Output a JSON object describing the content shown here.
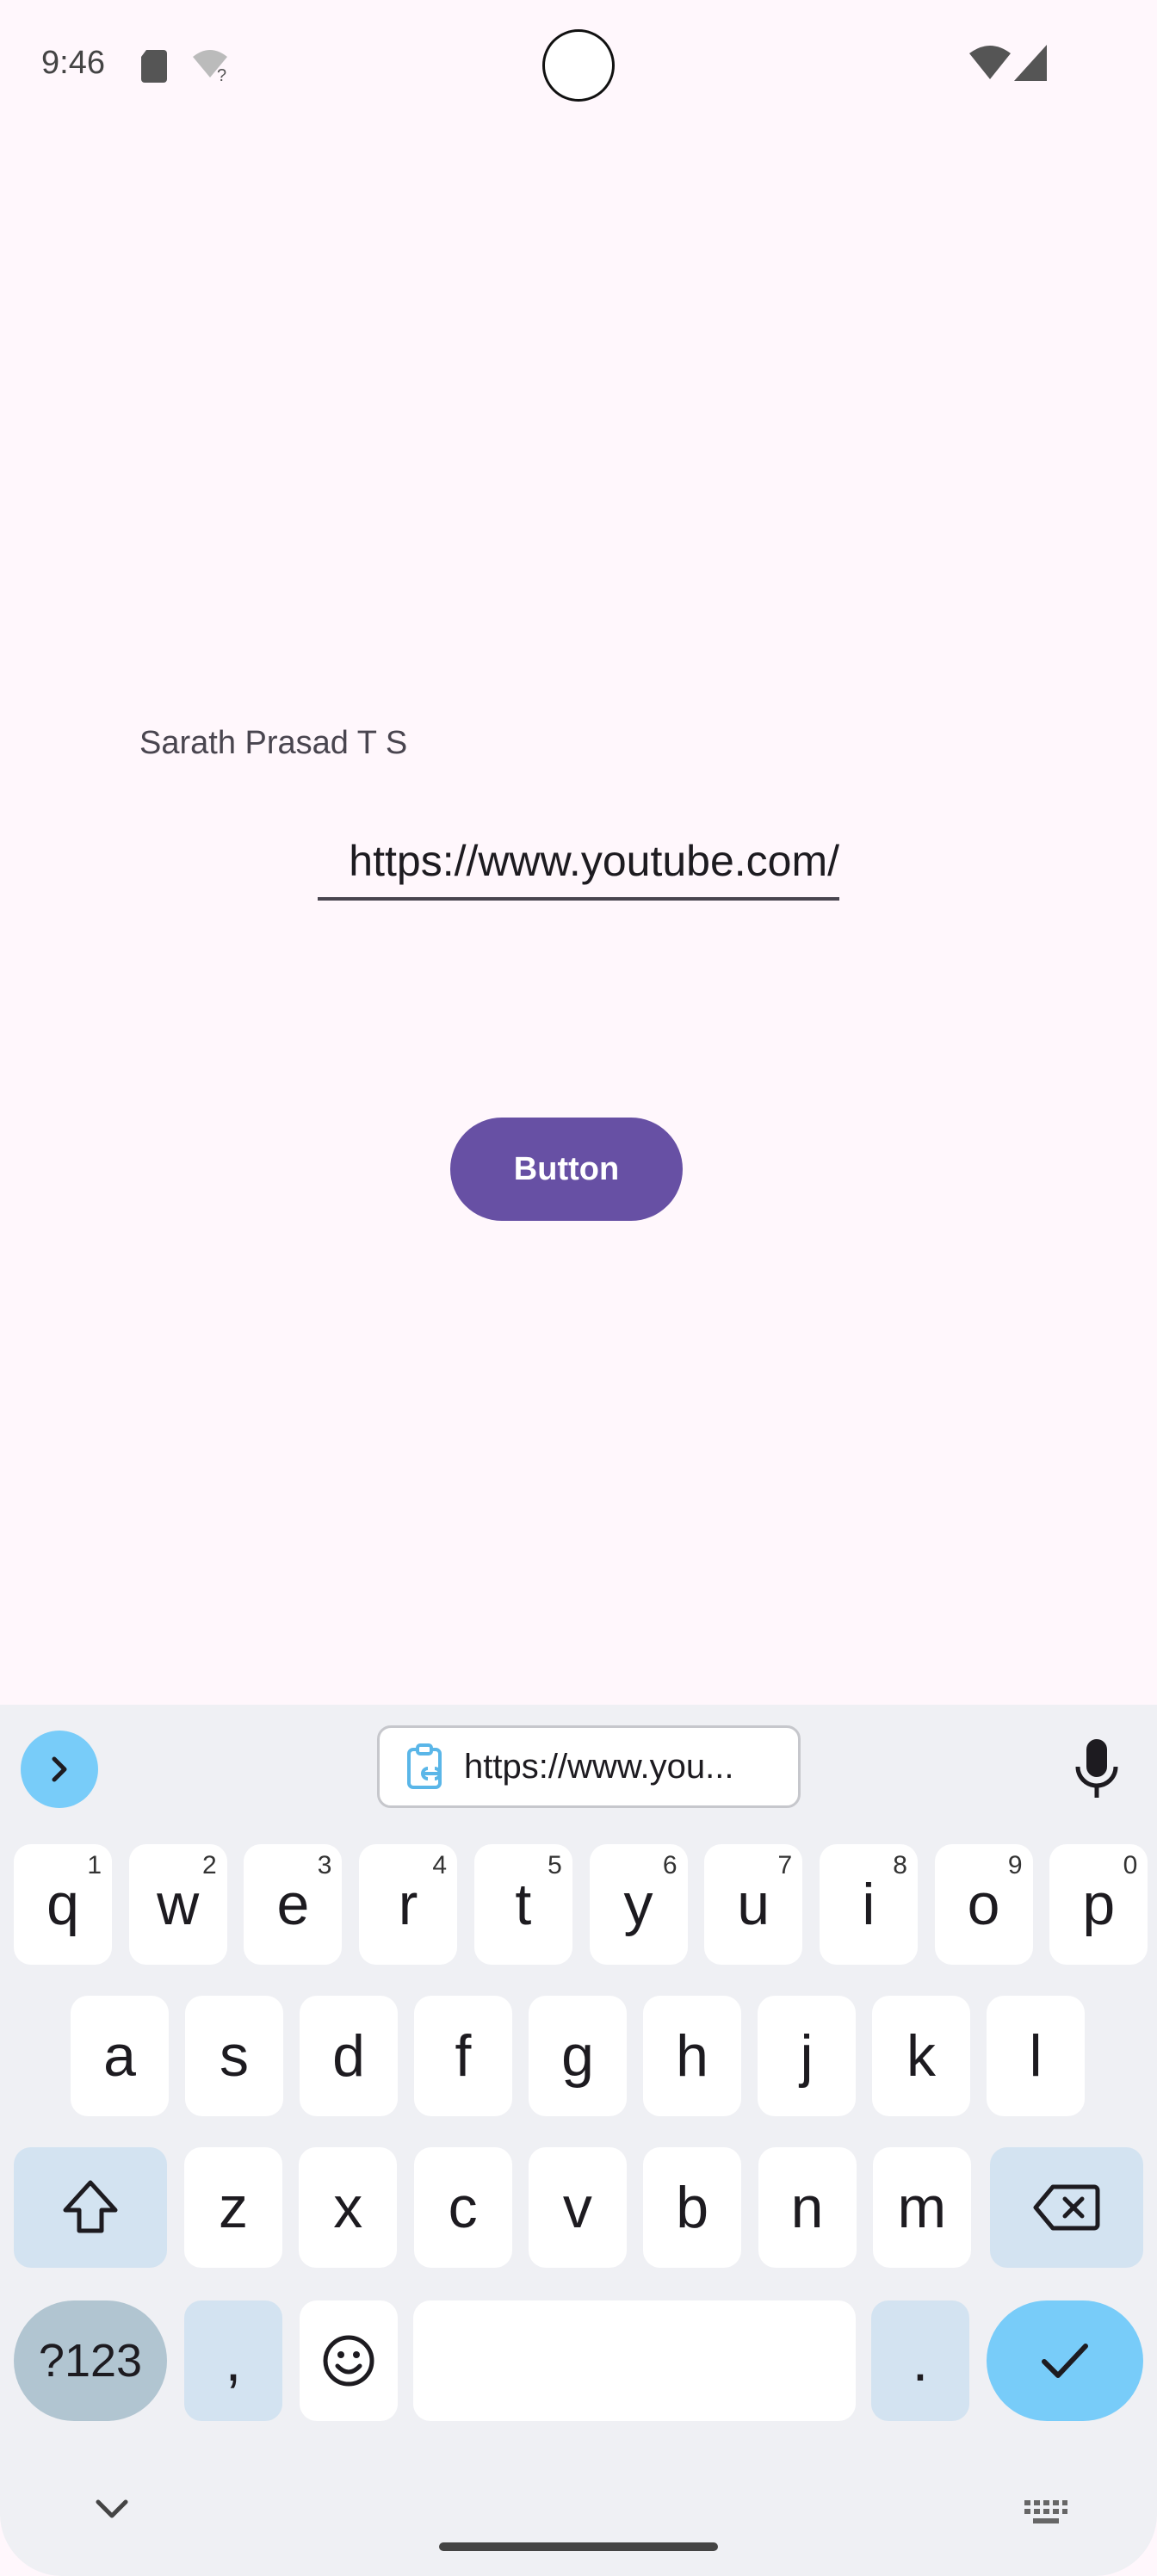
{
  "status_bar": {
    "time": "9:46",
    "icons": [
      "sd-card-icon",
      "wifi-question-icon",
      "wifi-icon",
      "signal-icon"
    ]
  },
  "app": {
    "name_label": "Sarath Prasad T S",
    "url_field": {
      "value": "https://www.youtube.com/"
    },
    "button_label": "Button"
  },
  "keyboard": {
    "clipboard_chip": "https://www.you...",
    "rows": [
      [
        {
          "k": "q",
          "h": "1"
        },
        {
          "k": "w",
          "h": "2"
        },
        {
          "k": "e",
          "h": "3"
        },
        {
          "k": "r",
          "h": "4"
        },
        {
          "k": "t",
          "h": "5"
        },
        {
          "k": "y",
          "h": "6"
        },
        {
          "k": "u",
          "h": "7"
        },
        {
          "k": "i",
          "h": "8"
        },
        {
          "k": "o",
          "h": "9"
        },
        {
          "k": "p",
          "h": "0"
        }
      ],
      [
        {
          "k": "a"
        },
        {
          "k": "s"
        },
        {
          "k": "d"
        },
        {
          "k": "f"
        },
        {
          "k": "g"
        },
        {
          "k": "h"
        },
        {
          "k": "j"
        },
        {
          "k": "k"
        },
        {
          "k": "l"
        }
      ],
      [
        {
          "k": "z"
        },
        {
          "k": "x"
        },
        {
          "k": "c"
        },
        {
          "k": "v"
        },
        {
          "k": "b"
        },
        {
          "k": "n"
        },
        {
          "k": "m"
        }
      ]
    ],
    "symbols_key": "?123",
    "comma_key": ",",
    "period_key": "."
  },
  "colors": {
    "background": "#fff7fc",
    "primary": "#6750a4",
    "keyboard_bg": "#eff0f4",
    "accent": "#78ccf9"
  }
}
